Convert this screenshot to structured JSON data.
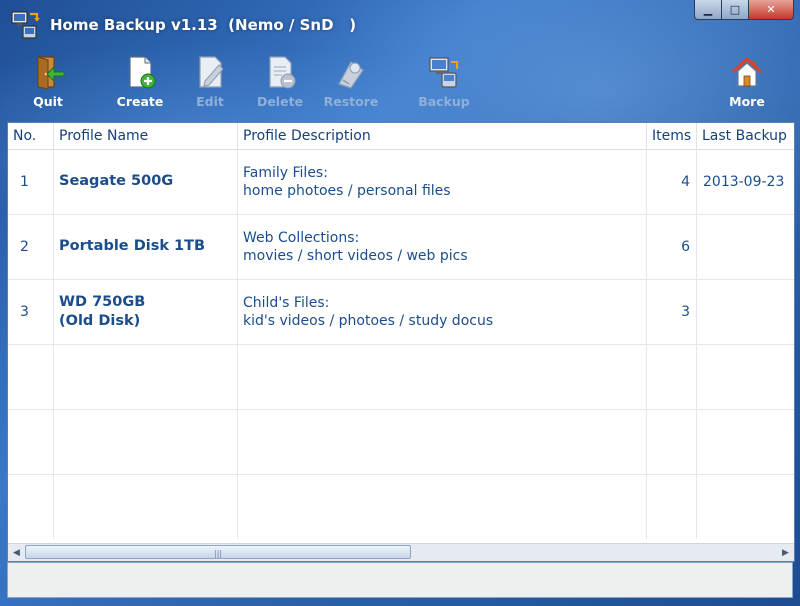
{
  "window": {
    "title": "Home Backup v1.13  (Nemo / SnD   )",
    "controls": {
      "minimize": "▁",
      "maximize": "□",
      "close": "✕"
    }
  },
  "toolbar": {
    "quit": {
      "label": "Quit",
      "icon": "exit-door-icon",
      "enabled": true
    },
    "create": {
      "label": "Create",
      "icon": "new-document-icon",
      "enabled": true
    },
    "edit": {
      "label": "Edit",
      "icon": "edit-document-icon",
      "enabled": false
    },
    "delete": {
      "label": "Delete",
      "icon": "delete-document-icon",
      "enabled": false
    },
    "restore": {
      "label": "Restore",
      "icon": "restore-icon",
      "enabled": false
    },
    "backup": {
      "label": "Backup",
      "icon": "backup-computer-icon",
      "enabled": false
    },
    "more": {
      "label": "More",
      "icon": "home-icon",
      "enabled": true
    }
  },
  "table": {
    "headers": {
      "no": "No.",
      "name": "Profile Name",
      "desc": "Profile Description",
      "items": "Items",
      "last": "Last Backup"
    },
    "rows": [
      {
        "no": "1",
        "name": "Seagate 500G",
        "name2": "",
        "desc1": "Family Files:",
        "desc2": "home photoes / personal files",
        "items": "4",
        "last": "2013-09-23"
      },
      {
        "no": "2",
        "name": "Portable Disk 1TB",
        "name2": "",
        "desc1": "Web Collections:",
        "desc2": "movies / short videos / web pics",
        "items": "6",
        "last": ""
      },
      {
        "no": "3",
        "name": "WD 750GB",
        "name2": "(Old Disk)",
        "desc1": "Child's Files:",
        "desc2": "kid's videos / photoes / study docus",
        "items": "3",
        "last": ""
      },
      {
        "no": "",
        "name": "",
        "name2": "",
        "desc1": "",
        "desc2": "",
        "items": "",
        "last": ""
      },
      {
        "no": "",
        "name": "",
        "name2": "",
        "desc1": "",
        "desc2": "",
        "items": "",
        "last": ""
      },
      {
        "no": "",
        "name": "",
        "name2": "",
        "desc1": "",
        "desc2": "",
        "items": "",
        "last": ""
      }
    ]
  },
  "scrollbar": {
    "left_arrow": "◀",
    "right_arrow": "▶",
    "grip": "|||"
  },
  "colors": {
    "text": "#1c4d8a",
    "header_text": "#173f7a",
    "window_blue": "#2c63ad"
  }
}
